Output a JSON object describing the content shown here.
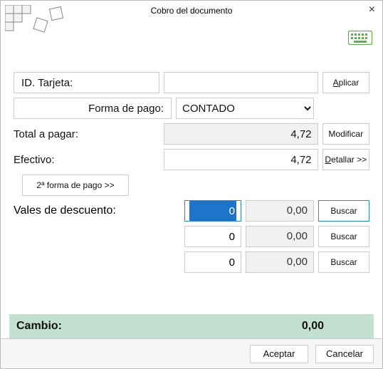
{
  "window": {
    "title": "Cobro del documento"
  },
  "labels": {
    "id_tarjeta": "ID. Tarjeta:",
    "forma_pago": "Forma de pago:",
    "total_pagar": "Total a pagar:",
    "efectivo": "Efectivo:",
    "vales": "Vales de descuento:",
    "cambio": "Cambio:"
  },
  "buttons": {
    "aplicar_prefix": "A",
    "aplicar_rest": "plicar",
    "modificar": "Modificar",
    "detallar_prefix": "D",
    "detallar_rest": "etallar >>",
    "segunda_forma": "2ª forma de pago >>",
    "buscar": "Buscar",
    "aceptar": "Aceptar",
    "cancelar": "Cancelar"
  },
  "fields": {
    "id_tarjeta": "",
    "forma_pago_selected": "CONTADO",
    "total_pagar": "4,72",
    "efectivo": "4,72",
    "cambio": "0,00"
  },
  "vouchers": [
    {
      "qty": "0",
      "amount": "0,00",
      "selected": true
    },
    {
      "qty": "0",
      "amount": "0,00",
      "selected": false
    },
    {
      "qty": "0",
      "amount": "0,00",
      "selected": false
    }
  ]
}
